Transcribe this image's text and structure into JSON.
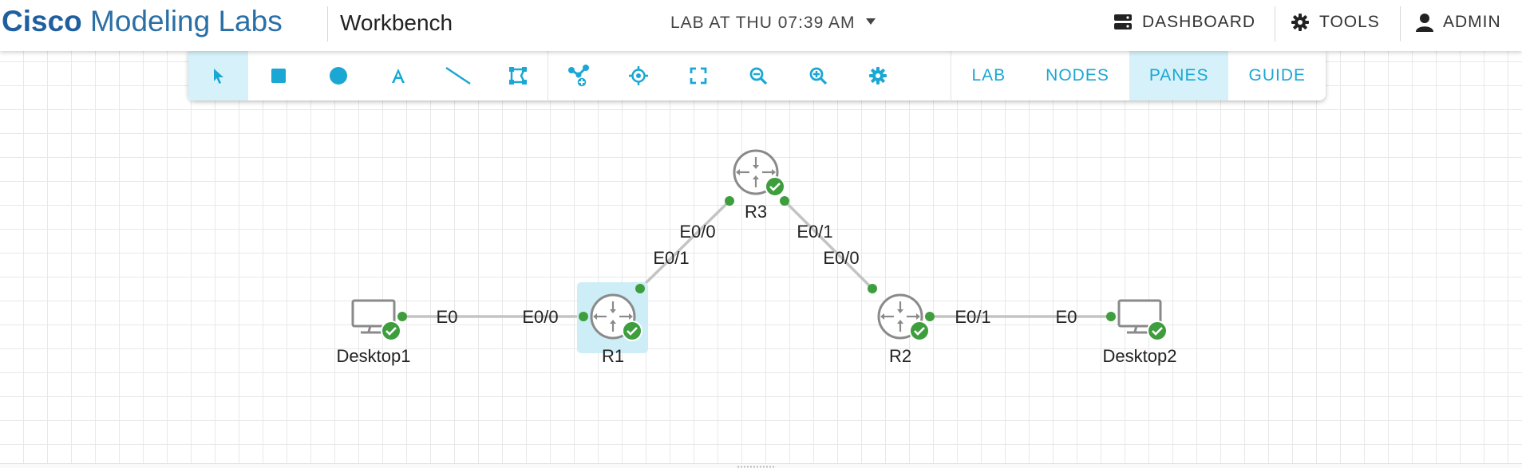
{
  "header": {
    "brand_bold": "Cisco",
    "brand_light": "Modeling Labs",
    "page_title": "Workbench",
    "lab_name": "LAB AT THU 07:39 AM",
    "dashboard_label": "DASHBOARD",
    "tools_label": "TOOLS",
    "user_label": "ADMIN"
  },
  "toolbar": {
    "tools": [
      "select-icon",
      "rectangle-icon",
      "ellipse-icon",
      "text-icon",
      "line-icon",
      "shape-edit-icon",
      "add-node-icon",
      "center-icon",
      "fit-screen-icon",
      "zoom-out-icon",
      "zoom-in-icon",
      "settings-icon"
    ],
    "active_tool": "select-icon",
    "tabs": {
      "lab": "LAB",
      "nodes": "NODES",
      "panes": "PANES",
      "guide": "GUIDE"
    },
    "active_tab": "PANES"
  },
  "topology": {
    "nodes": {
      "r3": {
        "label": "R3",
        "status": "booted"
      },
      "r1": {
        "label": "R1",
        "status": "booted",
        "selected": true
      },
      "r2": {
        "label": "R2",
        "status": "booted"
      },
      "desktop1": {
        "label": "Desktop1",
        "status": "booted"
      },
      "desktop2": {
        "label": "Desktop2",
        "status": "booted"
      }
    },
    "links": {
      "r3_r1": {
        "a_label": "E0/0",
        "b_label": "E0/1"
      },
      "r3_r2": {
        "a_label": "E0/1",
        "b_label": "E0/0"
      },
      "desktop1_r1": {
        "a_label": "E0",
        "b_label": "E0/0"
      },
      "r2_desktop2": {
        "a_label": "E0/1",
        "b_label": "E0"
      }
    }
  },
  "colors": {
    "accent": "#1aa7d4",
    "active_bg": "#d6f1f9",
    "status_ok": "#3e9e3e",
    "brand": "#1f5fa0"
  }
}
